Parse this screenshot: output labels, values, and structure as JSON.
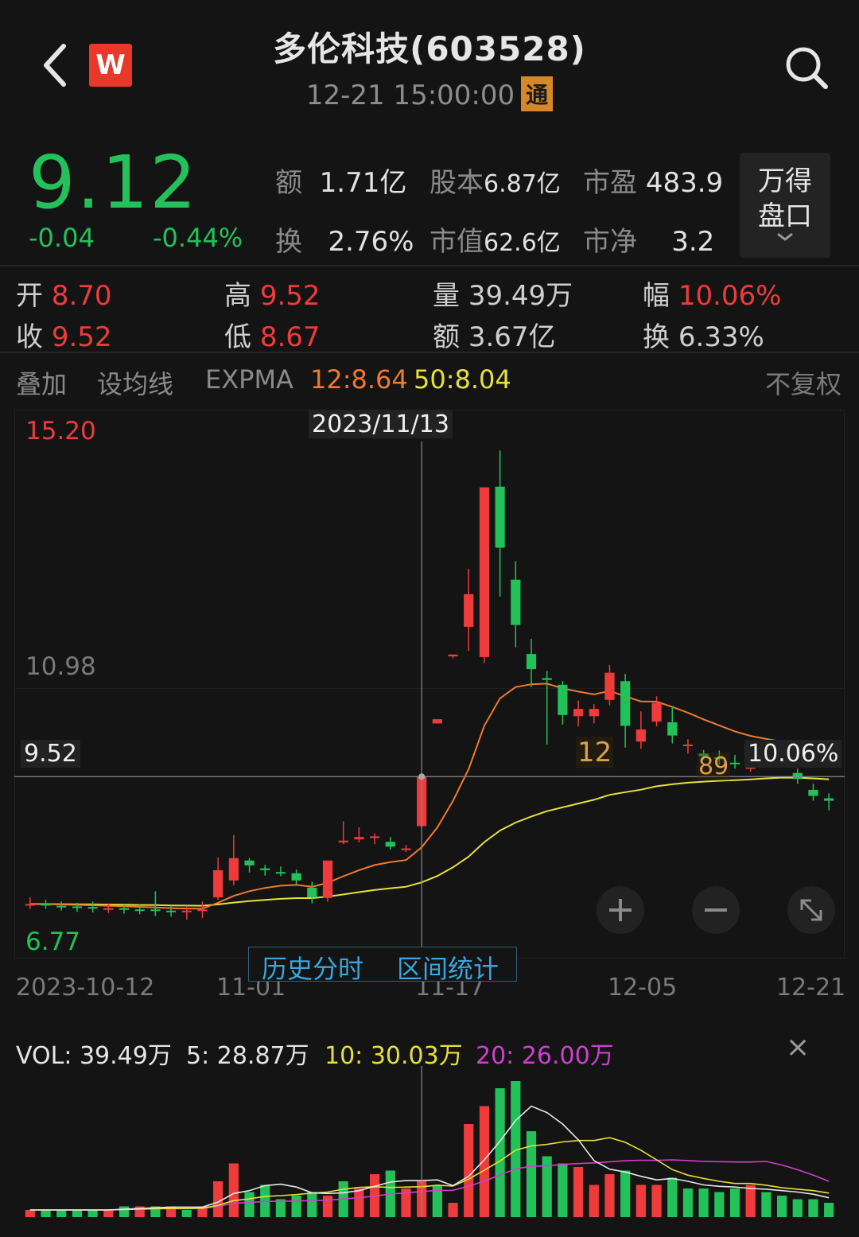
{
  "header": {
    "title": "多伦科技(603528)",
    "datetime": "12-21 15:00:00",
    "tong_badge": "通",
    "logo_letter": "W"
  },
  "quote": {
    "price": "9.12",
    "change": "-0.04",
    "change_pct": "-0.44%",
    "e_label": "额",
    "e_value": "1.71亿",
    "gb_label": "股本",
    "gb_value": "6.87亿",
    "sy_label": "市盈",
    "sy_value": "483.9",
    "h_label": "换",
    "h_value": "2.76%",
    "sz_label": "市值",
    "sz_value": "62.6亿",
    "sj_label": "市净",
    "sj_value": "3.2",
    "pankou_line1": "万得",
    "pankou_line2": "盘口"
  },
  "day": {
    "open_label": "开",
    "open_value": "8.70",
    "high_label": "高",
    "high_value": "9.52",
    "vol_label": "量",
    "vol_value": "39.49万",
    "amp_label": "幅",
    "amp_value": "10.06%",
    "close_label": "收",
    "close_value": "9.52",
    "low_label": "低",
    "low_value": "8.67",
    "amt_label": "额",
    "amt_value": "3.67亿",
    "turn_label": "换",
    "turn_value": "6.33%"
  },
  "toolbar": {
    "overlay": "叠加",
    "set_ma": "设均线",
    "expma": "EXPMA",
    "ema12": "12:8.64",
    "ema50": "50:8.04",
    "adjust": "不复权"
  },
  "chart": {
    "y_top": "15.20",
    "y_mid": "10.98",
    "y_bottom": "6.77",
    "crosshair_price": "9.52",
    "crosshair_date": "2023/11/13",
    "crosshair_pct": "10.06%",
    "marker_12": "12",
    "marker_89": "89",
    "x_labels": [
      "2023-10-12",
      "11-01",
      "11-17",
      "12-05",
      "12-21"
    ],
    "tab_history": "历史分时",
    "tab_range": "区间统计",
    "colors": {
      "up": "#ef3b3b",
      "down": "#22c15a",
      "ema12": "#f07a2c",
      "ema50": "#e7e03a"
    }
  },
  "chart_data": {
    "type": "candlestick",
    "y_axis_ticks": [
      15.2,
      10.98,
      6.77
    ],
    "x_ticks": [
      "2023-10-12",
      "11-01",
      "11-17",
      "12-05",
      "12-21"
    ],
    "candles": [
      {
        "o": 7.4,
        "c": 7.41,
        "h": 7.52,
        "l": 7.33
      },
      {
        "o": 7.41,
        "c": 7.4,
        "h": 7.48,
        "l": 7.33
      },
      {
        "o": 7.38,
        "c": 7.37,
        "h": 7.45,
        "l": 7.3
      },
      {
        "o": 7.37,
        "c": 7.36,
        "h": 7.43,
        "l": 7.28
      },
      {
        "o": 7.36,
        "c": 7.35,
        "h": 7.45,
        "l": 7.27
      },
      {
        "o": 7.33,
        "c": 7.34,
        "h": 7.42,
        "l": 7.26
      },
      {
        "o": 7.34,
        "c": 7.32,
        "h": 7.4,
        "l": 7.25
      },
      {
        "o": 7.32,
        "c": 7.31,
        "h": 7.4,
        "l": 7.24
      },
      {
        "o": 7.32,
        "c": 7.3,
        "h": 7.62,
        "l": 7.21
      },
      {
        "o": 7.3,
        "c": 7.28,
        "h": 7.38,
        "l": 7.2
      },
      {
        "o": 7.28,
        "c": 7.3,
        "h": 7.38,
        "l": 7.15
      },
      {
        "o": 7.3,
        "c": 7.32,
        "h": 7.45,
        "l": 7.18
      },
      {
        "o": 7.52,
        "c": 7.97,
        "h": 8.18,
        "l": 7.48
      },
      {
        "o": 7.8,
        "c": 8.17,
        "h": 8.55,
        "l": 7.72
      },
      {
        "o": 8.13,
        "c": 8.05,
        "h": 8.17,
        "l": 7.93
      },
      {
        "o": 8.0,
        "c": 7.97,
        "h": 8.06,
        "l": 7.88
      },
      {
        "o": 7.94,
        "c": 7.92,
        "h": 8.03,
        "l": 7.87
      },
      {
        "o": 7.92,
        "c": 7.8,
        "h": 7.98,
        "l": 7.74
      },
      {
        "o": 7.68,
        "c": 7.52,
        "h": 7.78,
        "l": 7.42
      },
      {
        "o": 7.51,
        "c": 8.13,
        "h": 8.13,
        "l": 7.45
      },
      {
        "o": 8.43,
        "c": 8.46,
        "h": 8.78,
        "l": 8.4
      },
      {
        "o": 8.48,
        "c": 8.52,
        "h": 8.68,
        "l": 8.43
      },
      {
        "o": 8.51,
        "c": 8.53,
        "h": 8.58,
        "l": 8.4
      },
      {
        "o": 8.44,
        "c": 8.36,
        "h": 8.52,
        "l": 8.31
      },
      {
        "o": 8.32,
        "c": 8.33,
        "h": 8.39,
        "l": 8.27
      },
      {
        "o": 8.7,
        "c": 9.52,
        "h": 9.52,
        "l": 8.67
      },
      {
        "o": 10.4,
        "c": 10.47,
        "h": 10.47,
        "l": 10.4
      },
      {
        "o": 11.51,
        "c": 11.54,
        "h": 11.54,
        "l": 11.48
      },
      {
        "o": 12.0,
        "c": 12.54,
        "h": 12.96,
        "l": 11.6
      },
      {
        "o": 11.5,
        "c": 14.31,
        "h": 14.31,
        "l": 11.4
      },
      {
        "o": 14.32,
        "c": 13.31,
        "h": 14.92,
        "l": 12.5
      },
      {
        "o": 12.78,
        "c": 12.03,
        "h": 13.09,
        "l": 11.66
      },
      {
        "o": 11.55,
        "c": 11.3,
        "h": 11.8,
        "l": 11.0
      },
      {
        "o": 11.15,
        "c": 11.12,
        "h": 11.27,
        "l": 10.05
      },
      {
        "o": 11.04,
        "c": 10.54,
        "h": 11.1,
        "l": 10.38
      },
      {
        "o": 10.52,
        "c": 10.64,
        "h": 10.78,
        "l": 10.35
      },
      {
        "o": 10.52,
        "c": 10.64,
        "h": 10.72,
        "l": 10.4
      },
      {
        "o": 10.79,
        "c": 11.24,
        "h": 11.37,
        "l": 10.7
      },
      {
        "o": 11.1,
        "c": 10.36,
        "h": 11.22,
        "l": 10.0
      },
      {
        "o": 10.1,
        "c": 10.3,
        "h": 10.6,
        "l": 9.98
      },
      {
        "o": 10.43,
        "c": 10.74,
        "h": 10.85,
        "l": 10.35
      },
      {
        "o": 10.42,
        "c": 10.2,
        "h": 10.69,
        "l": 10.07
      },
      {
        "o": 10.05,
        "c": 10.05,
        "h": 10.14,
        "l": 9.9
      },
      {
        "o": 9.9,
        "c": 9.86,
        "h": 9.96,
        "l": 9.8
      },
      {
        "o": 9.84,
        "c": 9.81,
        "h": 9.95,
        "l": 9.72
      },
      {
        "o": 9.75,
        "c": 9.73,
        "h": 9.88,
        "l": 9.65
      },
      {
        "o": 9.65,
        "c": 9.78,
        "h": 9.87,
        "l": 9.6
      },
      {
        "o": 9.9,
        "c": 9.87,
        "h": 10.11,
        "l": 9.8
      },
      {
        "o": 9.86,
        "c": 9.84,
        "h": 9.96,
        "l": 9.75
      },
      {
        "o": 9.58,
        "c": 9.48,
        "h": 9.65,
        "l": 9.4
      },
      {
        "o": 9.3,
        "c": 9.2,
        "h": 9.4,
        "l": 9.12
      },
      {
        "o": 9.16,
        "c": 9.12,
        "h": 9.24,
        "l": 8.96
      }
    ],
    "ema12_label": "12:8.64",
    "ema50_label": "50:8.04"
  },
  "volume": {
    "vol_label": "VOL: 39.49万",
    "ma5_label": "5: 28.87万",
    "ma10_label": "10: 30.03万",
    "ma20_label": "20: 26.00万",
    "close_label": "×"
  },
  "volume_data": {
    "type": "bar",
    "values": [
      2,
      2,
      2,
      2,
      2,
      2,
      3,
      3,
      3,
      3,
      2,
      3,
      10,
      15,
      7,
      9,
      5,
      6,
      7,
      6,
      10,
      8,
      12,
      13,
      8,
      10,
      9,
      4,
      26,
      31,
      36,
      38,
      24,
      17,
      15,
      14,
      9,
      12,
      13,
      9,
      9,
      11,
      8,
      8,
      7,
      8,
      9,
      7,
      6,
      5,
      5,
      4
    ],
    "up": [
      1,
      0,
      0,
      0,
      0,
      1,
      0,
      1,
      0,
      1,
      0,
      1,
      1,
      1,
      0,
      0,
      0,
      0,
      0,
      1,
      0,
      1,
      1,
      0,
      1,
      1,
      0,
      1,
      1,
      1,
      0,
      0,
      0,
      0,
      0,
      1,
      1,
      1,
      0,
      1,
      1,
      0,
      0,
      0,
      0,
      0,
      1,
      0,
      0,
      0,
      0,
      0
    ]
  }
}
